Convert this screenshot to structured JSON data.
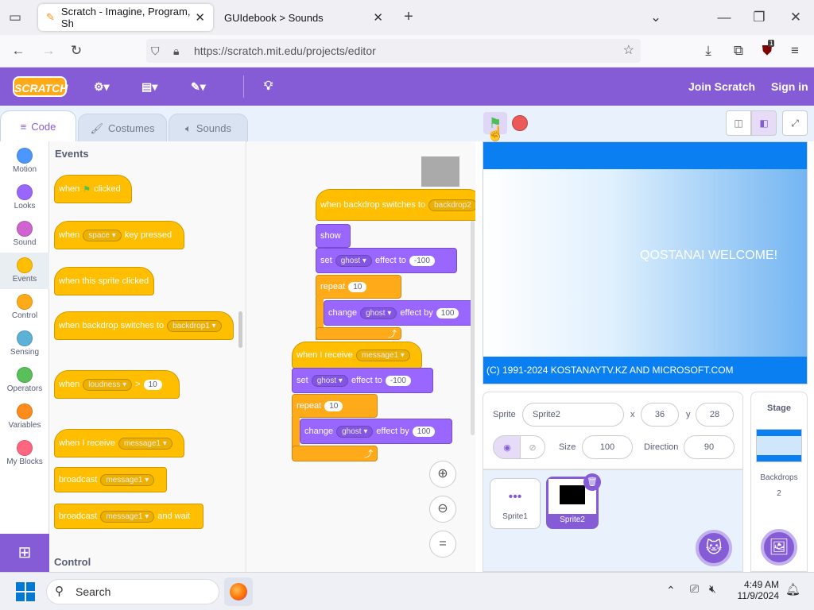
{
  "browser": {
    "tabs": [
      {
        "label": "Scratch - Imagine, Program, Sh"
      },
      {
        "label": "GUIdebook > Sounds"
      }
    ],
    "url": "https://scratch.mit.edu/projects/editor",
    "ext_badge": "1"
  },
  "menubar": {
    "logo": "SCRATCH",
    "join": "Join Scratch",
    "signin": "Sign in"
  },
  "editor_tabs": [
    "Code",
    "Costumes",
    "Sounds"
  ],
  "categories": [
    {
      "label": "Motion",
      "color": "#4c97ff"
    },
    {
      "label": "Looks",
      "color": "#9966ff"
    },
    {
      "label": "Sound",
      "color": "#cf63cf"
    },
    {
      "label": "Events",
      "color": "#ffbf00"
    },
    {
      "label": "Control",
      "color": "#ffab19"
    },
    {
      "label": "Sensing",
      "color": "#5cb1d6"
    },
    {
      "label": "Operators",
      "color": "#59c059"
    },
    {
      "label": "Variables",
      "color": "#ff8c1a"
    },
    {
      "label": "My Blocks",
      "color": "#ff6680"
    }
  ],
  "palette": {
    "heading": "Events",
    "heading2": "Control",
    "flag": {
      "w": "when",
      "t": "clicked"
    },
    "key": {
      "w": "when",
      "d": "space",
      "t": "key pressed"
    },
    "sprite": "when this sprite clicked",
    "backdrop": {
      "t": "when backdrop switches to",
      "d": "backdrop1"
    },
    "loud": {
      "w": "when",
      "d": "loudness",
      "op": ">",
      "n": "10"
    },
    "receive": {
      "t": "when I receive",
      "d": "message1"
    },
    "broadcast": {
      "t": "broadcast",
      "d": "message1"
    },
    "broadcastwait": {
      "t": "broadcast",
      "d": "message1",
      "t2": "and wait"
    }
  },
  "script": {
    "hat1": {
      "t": "when backdrop switches to",
      "d": "backdrop2"
    },
    "show": "show",
    "set1": {
      "t": "set",
      "d": "ghost",
      "t2": "effect to",
      "n": "-100"
    },
    "rep1": {
      "t": "repeat",
      "n": "10"
    },
    "chg1": {
      "t": "change",
      "d": "ghost",
      "t2": "effect by",
      "n": "100"
    },
    "hat2": {
      "t": "when I receive",
      "d": "message1"
    },
    "set2": {
      "t": "set",
      "d": "ghost",
      "t2": "effect to",
      "n": "-100"
    },
    "rep2": {
      "t": "repeat",
      "n": "10"
    },
    "chg2": {
      "t": "change",
      "d": "ghost",
      "t2": "effect by",
      "n": "100"
    },
    "zoom_reset": "="
  },
  "stage": {
    "welcome": "QOSTANAI WELCOME!",
    "copyright": "(C) 1991-2024 KOSTANAYTV.KZ AND MICROSOFT.COM"
  },
  "sprite": {
    "label": "Sprite",
    "name": "Sprite2",
    "x_label": "x",
    "x": "36",
    "y_label": "y",
    "y": "28",
    "size_label": "Size",
    "size": "100",
    "dir_label": "Direction",
    "dir": "90"
  },
  "sprites": [
    "Sprite1",
    "Sprite2"
  ],
  "stage_panel": {
    "title": "Stage",
    "backdrops_label": "Backdrops",
    "backdrops_count": "2"
  },
  "taskbar": {
    "search": "Search",
    "time": "4:49 AM",
    "date": "11/9/2024"
  }
}
